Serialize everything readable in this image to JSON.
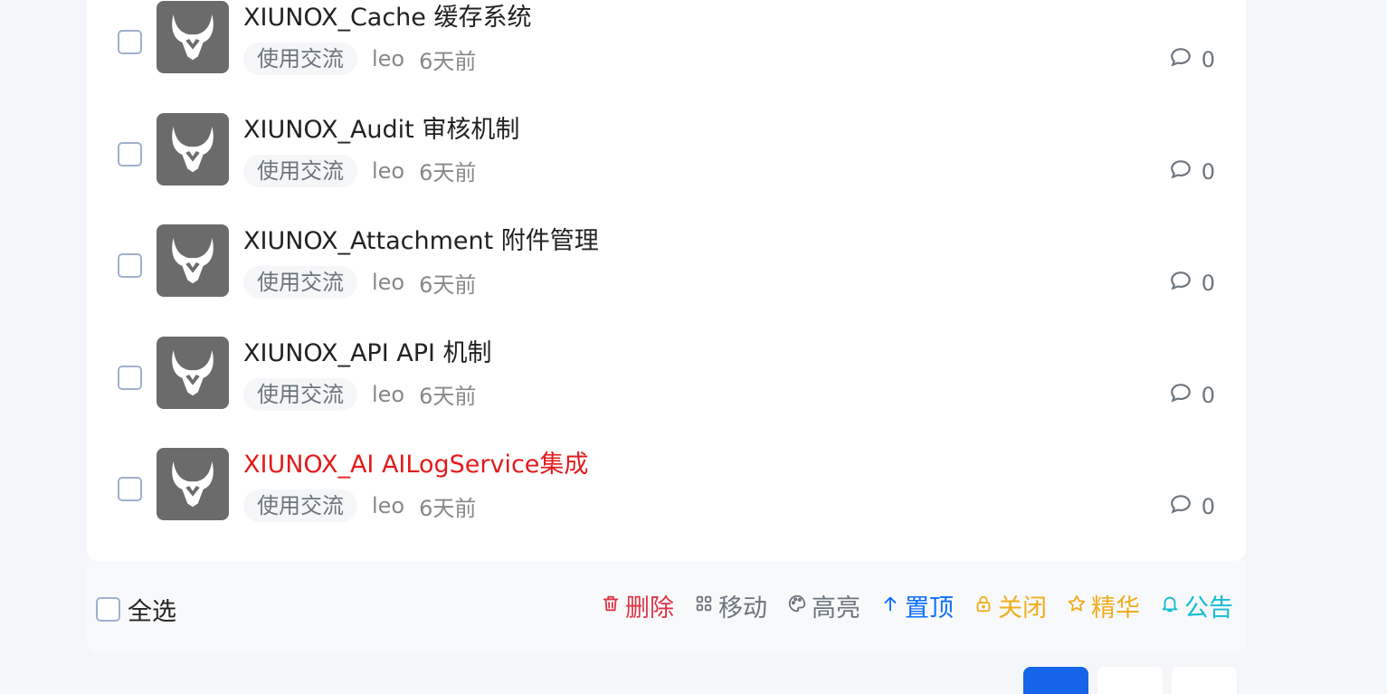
{
  "threads": [
    {
      "title": "XIUNOX_Cache 缓存系统",
      "tag": "使用交流",
      "author": "leo",
      "time": "6天前",
      "replies": "0",
      "highlight": false
    },
    {
      "title": "XIUNOX_Audit 审核机制",
      "tag": "使用交流",
      "author": "leo",
      "time": "6天前",
      "replies": "0",
      "highlight": false
    },
    {
      "title": "XIUNOX_Attachment 附件管理",
      "tag": "使用交流",
      "author": "leo",
      "time": "6天前",
      "replies": "0",
      "highlight": false
    },
    {
      "title": "XIUNOX_API API 机制",
      "tag": "使用交流",
      "author": "leo",
      "time": "6天前",
      "replies": "0",
      "highlight": false
    },
    {
      "title": "XIUNOX_AI AILogService集成",
      "tag": "使用交流",
      "author": "leo",
      "time": "6天前",
      "replies": "0",
      "highlight": true
    }
  ],
  "bulk": {
    "select_all": "全选",
    "actions": [
      {
        "key": "delete",
        "label": "删除",
        "icon": "trash-icon",
        "color": "#dc3545"
      },
      {
        "key": "move",
        "label": "移动",
        "icon": "grid-icon",
        "color": "#6c757d"
      },
      {
        "key": "highlight",
        "label": "高亮",
        "icon": "palette-icon",
        "color": "#6c757d"
      },
      {
        "key": "top",
        "label": "置顶",
        "icon": "arrow-up-icon",
        "color": "#0d6efd"
      },
      {
        "key": "close",
        "label": "关闭",
        "icon": "lock-icon",
        "color": "#f0ad1c"
      },
      {
        "key": "digest",
        "label": "精华",
        "icon": "star-icon",
        "color": "#f0ad1c"
      },
      {
        "key": "notice",
        "label": "公告",
        "icon": "bell-icon",
        "color": "#17bcd4"
      }
    ]
  },
  "colors": {
    "accent": "#1565e8",
    "highlight_title": "#e11c1c"
  }
}
